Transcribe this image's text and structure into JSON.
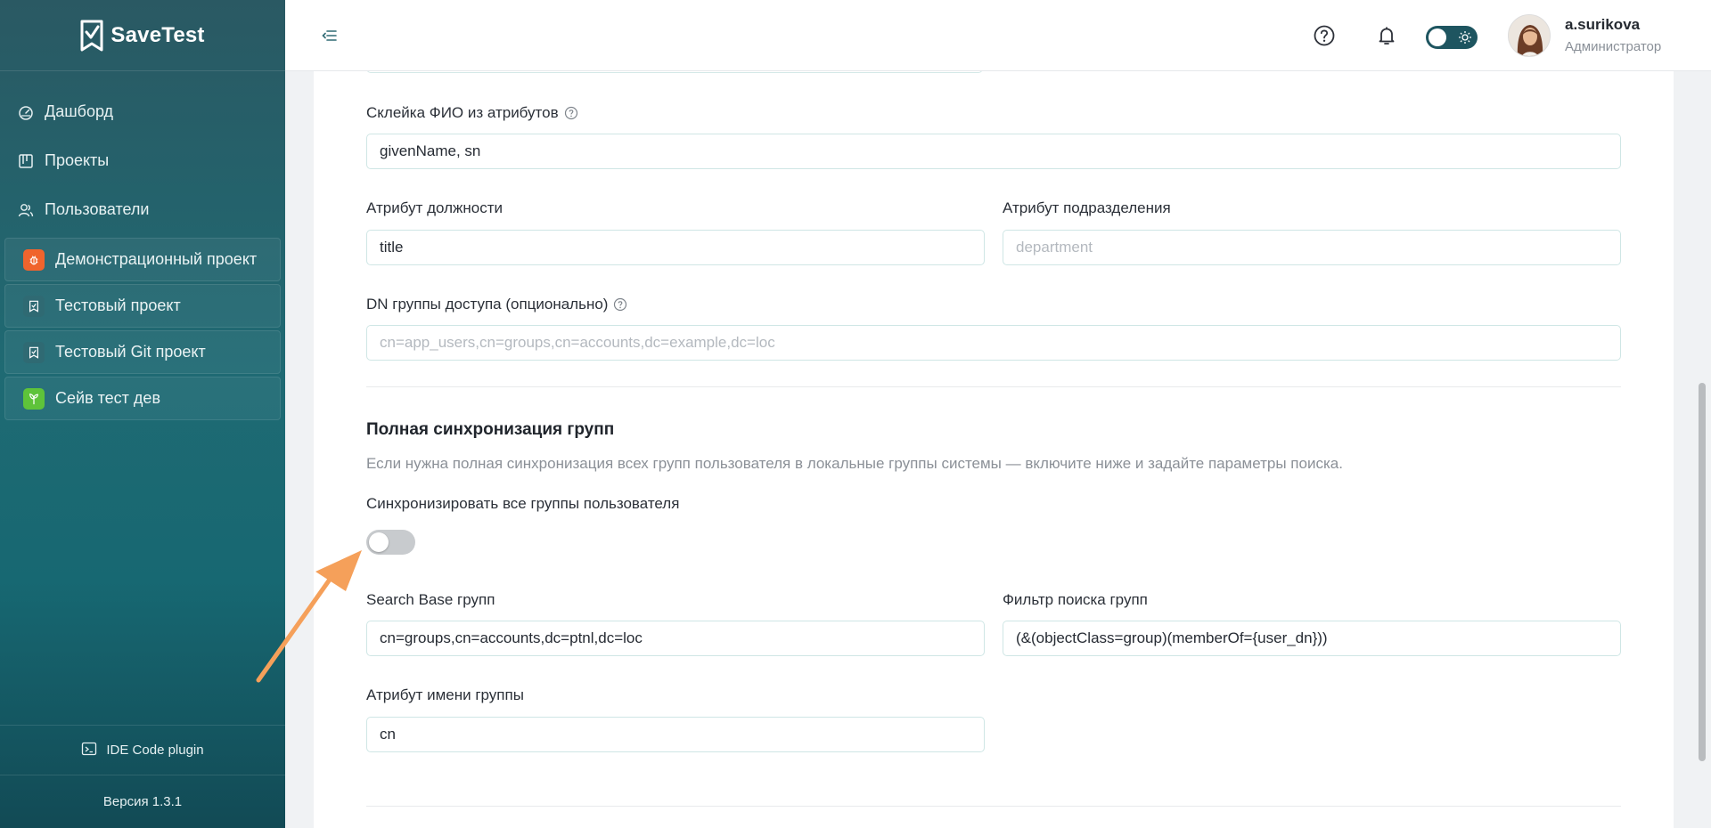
{
  "app": {
    "name": "SaveTest"
  },
  "sidebar": {
    "nav": [
      {
        "label": "Дашборд",
        "icon": "dashboard-icon"
      },
      {
        "label": "Проекты",
        "icon": "projects-icon"
      },
      {
        "label": "Пользователи",
        "icon": "users-icon"
      }
    ],
    "projects": [
      {
        "label": "Демонстрационный проект",
        "icon": "bug-icon",
        "color": "#f0642d"
      },
      {
        "label": "Тестовый проект",
        "icon": "checklist-icon",
        "color": "#2f6a73"
      },
      {
        "label": "Тестовый Git проект",
        "icon": "checklist-icon",
        "color": "#2f6a73"
      },
      {
        "label": "Сейв тест дев",
        "icon": "sprout-icon",
        "color": "#5ec33a"
      }
    ],
    "ide_link": "IDE Code plugin",
    "version": "Версия 1.3.1"
  },
  "header": {
    "user": {
      "name": "a.surikova",
      "role": "Администратор"
    },
    "theme": "light"
  },
  "form": {
    "fio": {
      "label": "Склейка ФИО из атрибутов",
      "value": "givenName, sn"
    },
    "position_attr": {
      "label": "Атрибут должности",
      "value": "title"
    },
    "department_attr": {
      "label": "Атрибут подразделения",
      "value": "",
      "placeholder": "department"
    },
    "dn_group": {
      "label": "DN группы доступа (опционально)",
      "value": "",
      "placeholder": "cn=app_users,cn=groups,cn=accounts,dc=example,dc=loc"
    },
    "sync_section": {
      "title": "Полная синхронизация групп",
      "description": "Если нужна полная синхронизация всех групп пользователя в локальные группы системы — включите ниже и задайте параметры поиска.",
      "toggle_label": "Синхронизировать все группы пользователя",
      "toggle_on": false
    },
    "search_base": {
      "label": "Search Base групп",
      "value": "cn=groups,cn=accounts,dc=ptnl,dc=loc"
    },
    "group_filter": {
      "label": "Фильтр поиска групп",
      "value": "(&(objectClass=group)(memberOf={user_dn}))"
    },
    "group_name_attr": {
      "label": "Атрибут имени группы",
      "value": "cn"
    }
  },
  "colors": {
    "accent": "#1f6a73",
    "annotation_arrow": "#f5a05a"
  }
}
